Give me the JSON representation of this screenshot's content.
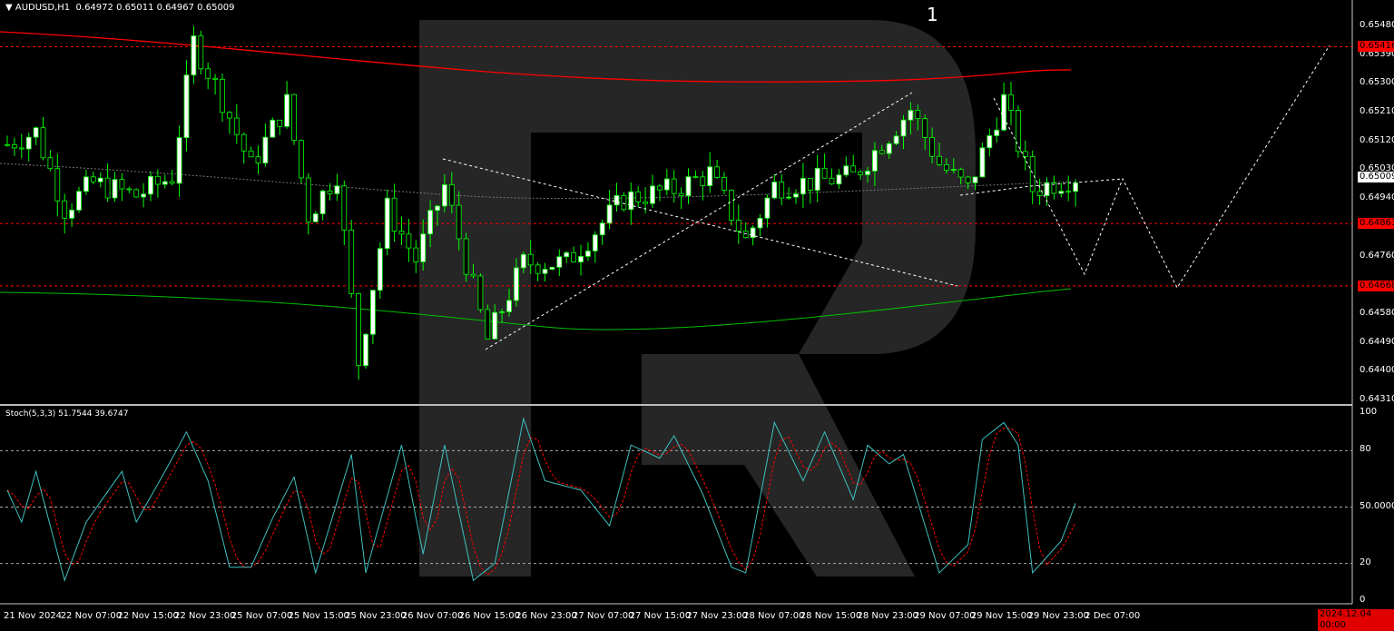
{
  "header": {
    "symbol": "AUDUSD,H1",
    "open": "0.64972",
    "high": "0.65011",
    "low": "0.64967",
    "close": "0.65009"
  },
  "wave_label": "1",
  "stoch_label": "Stoch(5,3,3) 51.7544 39.6747",
  "price_axis": [
    "0.65480",
    "0.65390",
    "0.65300",
    "0.65210",
    "0.65120",
    "0.65030",
    "0.64940",
    "0.64850",
    "0.64760",
    "0.64580",
    "0.64490",
    "0.64400",
    "0.64310"
  ],
  "price_tags": {
    "current": "0.65009",
    "level_top": "0.65416",
    "level_mid": "0.64863",
    "level_low": "0.64668"
  },
  "stoch_axis": [
    "100",
    "80",
    "50.0000",
    "20",
    "0"
  ],
  "time_axis": [
    "21 Nov 2024",
    "22 Nov 07:00",
    "22 Nov 15:00",
    "22 Nov 23:00",
    "25 Nov 07:00",
    "25 Nov 15:00",
    "25 Nov 23:00",
    "26 Nov 07:00",
    "26 Nov 15:00",
    "26 Nov 23:00",
    "27 Nov 07:00",
    "27 Nov 15:00",
    "27 Nov 23:00",
    "28 Nov 07:00",
    "28 Nov 15:00",
    "28 Nov 23:00",
    "29 Nov 07:00",
    "29 Nov 15:00",
    "29 Nov 23:00",
    "2 Dec 07:00"
  ],
  "time_tag": "2024.12.04 00:00",
  "colors": {
    "bull": "#ffffff",
    "bear": "#000000",
    "wick": "#00ff00",
    "level": "#ff0000",
    "ma_slow": "#ff0000",
    "ma_fast": "#00c000",
    "stoch_k": "#40c0c0",
    "stoch_d": "#ff0000"
  },
  "chart_data": {
    "type": "candlestick",
    "ylim": [
      0.6431,
      0.6548
    ],
    "price_path": [
      [
        0,
        0.6511
      ],
      [
        4,
        0.6515
      ],
      [
        8,
        0.6491
      ],
      [
        12,
        0.6499
      ],
      [
        18,
        0.6495
      ],
      [
        23,
        0.6501
      ],
      [
        26,
        0.6543
      ],
      [
        30,
        0.6525
      ],
      [
        34,
        0.6504
      ],
      [
        39,
        0.6524
      ],
      [
        42,
        0.6489
      ],
      [
        46,
        0.6502
      ],
      [
        49,
        0.6443
      ],
      [
        53,
        0.6491
      ],
      [
        57,
        0.6475
      ],
      [
        61,
        0.6498
      ],
      [
        67,
        0.645
      ],
      [
        72,
        0.6474
      ],
      [
        78,
        0.6474
      ],
      [
        86,
        0.6494
      ],
      [
        93,
        0.6497
      ],
      [
        98,
        0.6502
      ],
      [
        103,
        0.6481
      ],
      [
        107,
        0.6498
      ],
      [
        118,
        0.6501
      ],
      [
        126,
        0.6522
      ],
      [
        130,
        0.6505
      ],
      [
        134,
        0.6497
      ],
      [
        139,
        0.6525
      ],
      [
        143,
        0.6497
      ],
      [
        149,
        0.6501
      ]
    ],
    "levels": [
      0.65416,
      0.64863,
      0.64668
    ],
    "stoch_k": [
      [
        0,
        59
      ],
      [
        2,
        42
      ],
      [
        4,
        69
      ],
      [
        8,
        11
      ],
      [
        11,
        42
      ],
      [
        16,
        69
      ],
      [
        18,
        42
      ],
      [
        22,
        69
      ],
      [
        25,
        90
      ],
      [
        28,
        64
      ],
      [
        31,
        18
      ],
      [
        34,
        18
      ],
      [
        37,
        44
      ],
      [
        40,
        66
      ],
      [
        43,
        15
      ],
      [
        48,
        78
      ],
      [
        50,
        15
      ],
      [
        55,
        83
      ],
      [
        58,
        25
      ],
      [
        61,
        83
      ],
      [
        65,
        11
      ],
      [
        68,
        20
      ],
      [
        72,
        97
      ],
      [
        75,
        64
      ],
      [
        80,
        59
      ],
      [
        84,
        40
      ],
      [
        87,
        83
      ],
      [
        91,
        76
      ],
      [
        93,
        88
      ],
      [
        97,
        57
      ],
      [
        101,
        18
      ],
      [
        103,
        15
      ],
      [
        107,
        95
      ],
      [
        111,
        64
      ],
      [
        114,
        90
      ],
      [
        118,
        54
      ],
      [
        120,
        83
      ],
      [
        123,
        73
      ],
      [
        125,
        78
      ],
      [
        130,
        15
      ],
      [
        134,
        30
      ],
      [
        136,
        86
      ],
      [
        139,
        95
      ],
      [
        141,
        83
      ],
      [
        143,
        15
      ],
      [
        147,
        32
      ],
      [
        149,
        52
      ]
    ],
    "stoch_ylim": [
      0,
      100
    ]
  }
}
